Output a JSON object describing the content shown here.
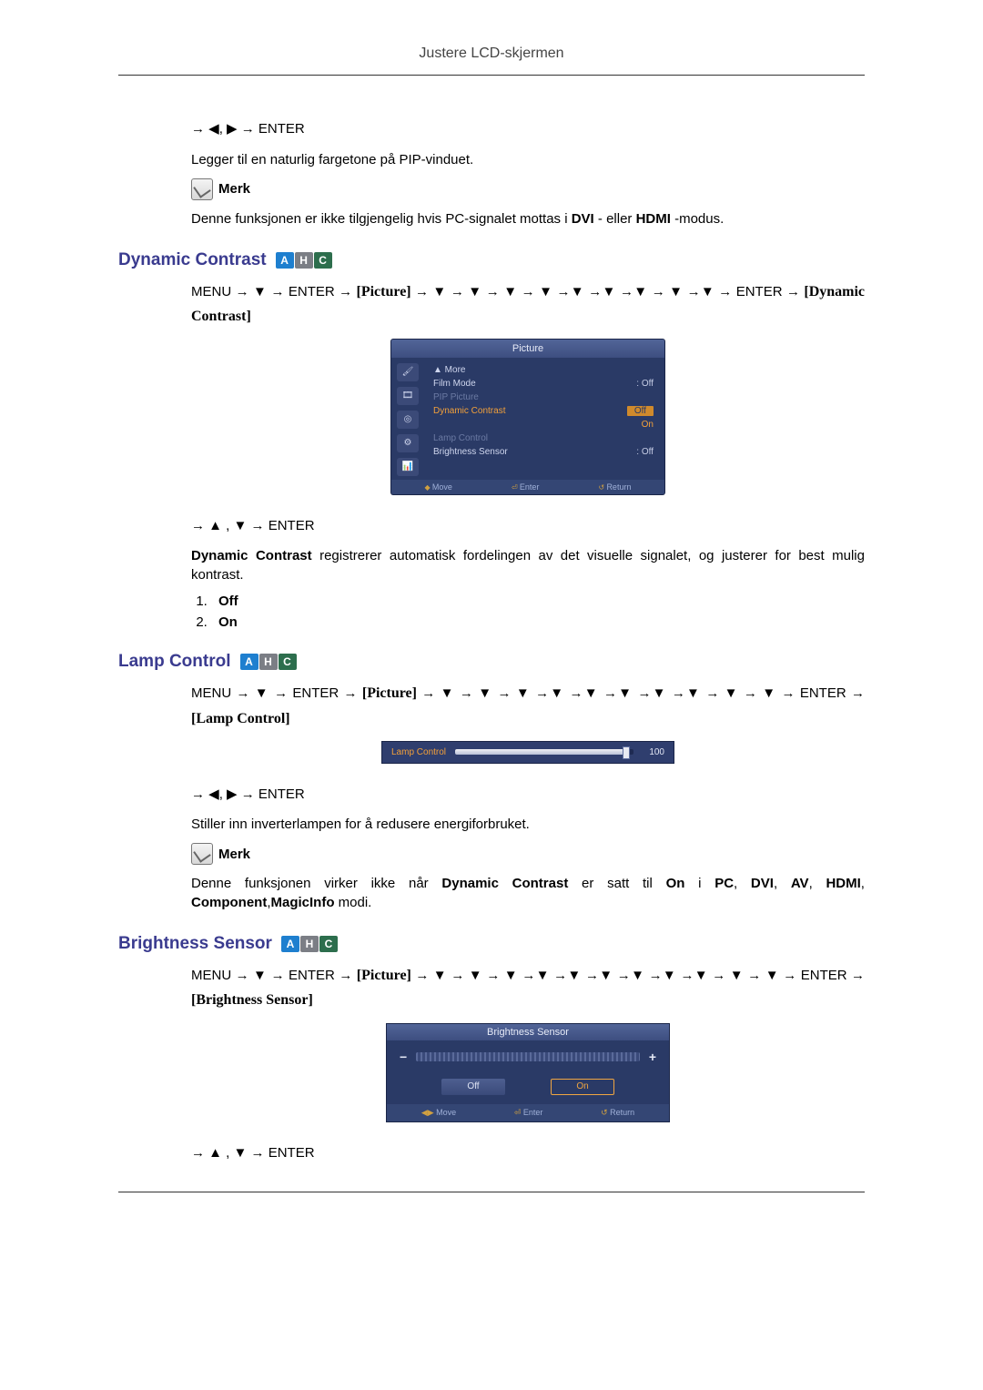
{
  "header": "Justere LCD-skjermen",
  "intro": {
    "nav1": "→ ◀, ▶ → ENTER",
    "para": "Legger til en naturlig fargetone på PIP-vinduet.",
    "note_label": "Merk",
    "note_text_prefix": "Denne funksjonen er ikke tilgjengelig hvis PC-signalet mottas i ",
    "note_bold1": "DVI",
    "note_middle": "- eller ",
    "note_bold2": "HDMI",
    "note_suffix": "-modus."
  },
  "badges": {
    "a": "A",
    "h": "H",
    "c": "C"
  },
  "dynamic_contrast": {
    "title": "Dynamic Contrast",
    "nav_line": "MENU → ▼ → ENTER → [Picture] → ▼ → ▼ → ▼ → ▼ →▼ →▼ →▼ → ▼ →▼ → ENTER → [Dynamic Contrast]",
    "osd": {
      "title": "Picture",
      "more": "▲ More",
      "rows": [
        {
          "label": "Film Mode",
          "value": ": Off",
          "state": "normal"
        },
        {
          "label": "PIP Picture",
          "value": "",
          "state": "muted"
        },
        {
          "label": "Dynamic Contrast",
          "value_off": "Off",
          "value_on": "On",
          "state": "highlight"
        },
        {
          "label": "Lamp Control",
          "value": "",
          "state": "muted"
        },
        {
          "label": "Brightness Sensor",
          "value": ": Off",
          "state": "normal"
        }
      ],
      "footer": {
        "move": "Move",
        "enter": "Enter",
        "return": "Return"
      }
    },
    "nav2": "→ ▲ , ▼ → ENTER",
    "desc_bold": "Dynamic Contrast",
    "desc_rest": "  registrerer automatisk fordelingen av det visuelle signalet, og justerer for best mulig kontrast.",
    "options": [
      "Off",
      "On"
    ]
  },
  "lamp_control": {
    "title": "Lamp Control",
    "nav_line": "MENU → ▼ → ENTER → [Picture] → ▼ → ▼ → ▼ →▼ →▼ →▼ →▼ →▼ → ▼ → ▼ → ENTER → [Lamp Control]",
    "osd": {
      "label": "Lamp Control",
      "value": "100"
    },
    "nav2": "→ ◀, ▶ → ENTER",
    "para": "Stiller inn inverterlampen for å redusere energiforbruket.",
    "note_label": "Merk",
    "note_text": "Denne funksjonen virker ikke når Dynamic Contrast er satt til On i PC, DVI, AV, HDMI, Component,MagicInfo modi."
  },
  "brightness_sensor": {
    "title": "Brightness Sensor",
    "nav_line": "MENU → ▼ → ENTER → [Picture] → ▼ → ▼ → ▼ →▼ →▼ →▼ →▼ →▼ →▼ → ▼ → ▼ → ENTER → [Brightness Sensor]",
    "osd": {
      "title": "Brightness Sensor",
      "off": "Off",
      "on": "On",
      "footer": {
        "move": "Move",
        "enter": "Enter",
        "return": "Return"
      }
    },
    "nav2": "→ ▲ , ▼ → ENTER"
  }
}
